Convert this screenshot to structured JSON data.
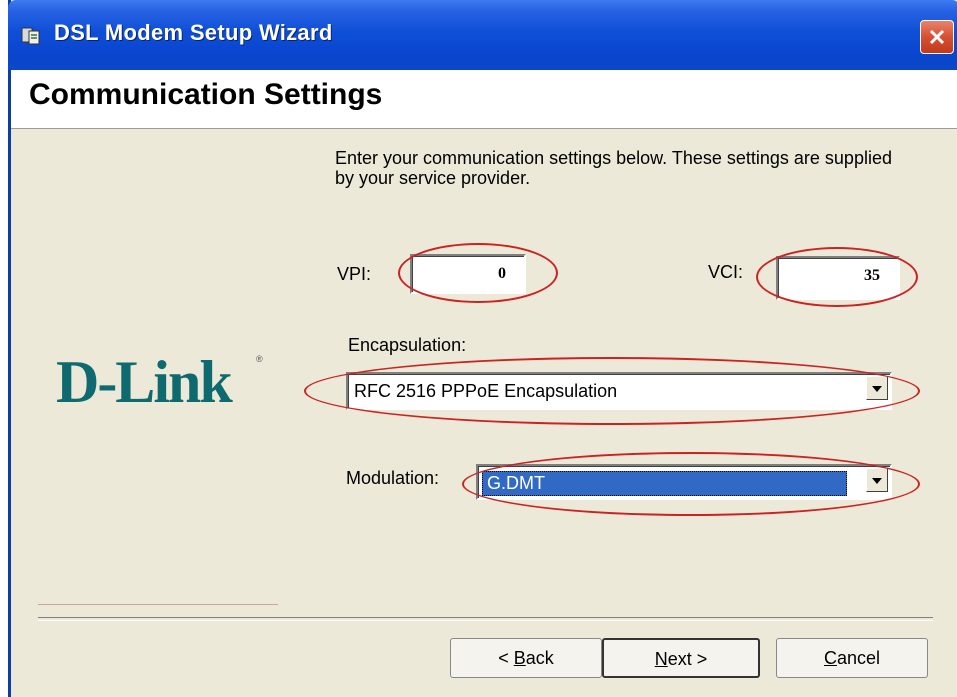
{
  "window": {
    "title": "DSL Modem Setup Wizard",
    "icons": {
      "app": "wizard-icon",
      "close": "close-icon"
    }
  },
  "header": {
    "title": "Communication Settings"
  },
  "logo": {
    "text": "D-Link",
    "reg": "®"
  },
  "instructions": "Enter your communication settings below.  These settings are supplied by your service provider.",
  "fields": {
    "vpi": {
      "label": "VPI:",
      "value": "0"
    },
    "vci": {
      "label": "VCI:",
      "value": "35"
    },
    "encapsulation": {
      "label": "Encapsulation:",
      "value": "RFC 2516 PPPoE Encapsulation"
    },
    "modulation": {
      "label": "Modulation:",
      "value": "G.DMT"
    }
  },
  "buttons": {
    "back": {
      "hotkey": "B",
      "rest": "ack",
      "prefix": "< "
    },
    "next": {
      "hotkey": "N",
      "rest": "ext >"
    },
    "cancel": {
      "hotkey": "C",
      "rest": "ancel"
    }
  },
  "colors": {
    "titlebar": "#0A46CF",
    "logo": "#0E6A6F",
    "highlight": "#316AC5",
    "annotation": "#CC2222"
  }
}
